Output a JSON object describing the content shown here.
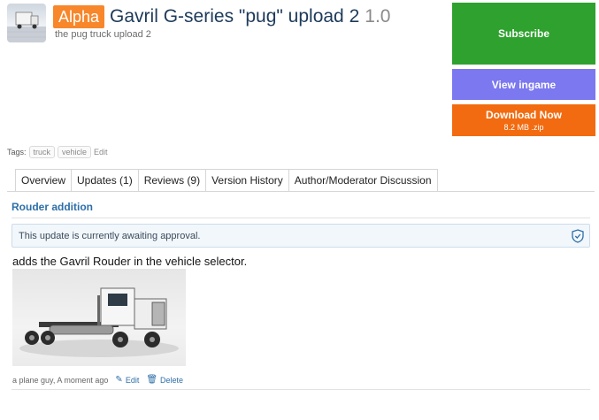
{
  "header": {
    "badge": "Alpha",
    "title": "Gavril G-series \"pug\" upload 2",
    "version": "1.0",
    "subtitle": "the pug truck upload 2"
  },
  "actions": {
    "subscribe": "Subscribe",
    "view_ingame": "View ingame",
    "download": "Download Now",
    "download_size": "8.2 MB .zip"
  },
  "tags": {
    "label": "Tags:",
    "items": [
      "truck",
      "vehicle"
    ],
    "edit": "Edit"
  },
  "tabs": [
    "Overview",
    "Updates (1)",
    "Reviews (9)",
    "Version History",
    "Author/Moderator Discussion"
  ],
  "update": {
    "title": "Rouder addition",
    "notice": "This update is currently awaiting approval.",
    "description": "adds the Gavril Rouder in the vehicle selector.",
    "author_meta": "a plane guy, A moment ago",
    "edit": "Edit",
    "delete": "Delete"
  },
  "colors": {
    "badge": "#f7872a",
    "subscribe": "#2ea12e",
    "view_ingame": "#7b78f0",
    "download": "#f26b10",
    "link": "#2d6fa8"
  },
  "icons": [
    "shield-check-icon",
    "pencil-icon",
    "trash-icon"
  ]
}
